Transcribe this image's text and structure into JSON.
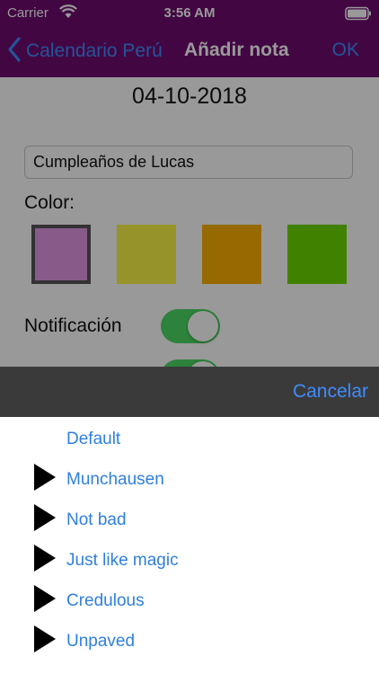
{
  "status_bar": {
    "carrier": "Carrier",
    "time": "3:56 AM"
  },
  "nav": {
    "back_label": "Calendario Perú",
    "title": "Añadir nota",
    "ok_label": "OK"
  },
  "form": {
    "date": "04-10-2018",
    "note_value": "Cumpleaños de Lucas",
    "color_label": "Color:",
    "swatches": [
      {
        "color": "#e197e6",
        "selected": true
      },
      {
        "color": "#f9f545"
      },
      {
        "color": "#fab100"
      },
      {
        "color": "#6cd900"
      }
    ],
    "notification_label": "Notificación",
    "notification_on": true
  },
  "sheet": {
    "cancel_label": "Cancelar",
    "sounds": [
      {
        "label": "Default",
        "icon": "none"
      },
      {
        "label": "Munchausen",
        "icon": "play-icon"
      },
      {
        "label": "Not bad",
        "icon": "play-icon"
      },
      {
        "label": "Just like magic",
        "icon": "play-icon"
      },
      {
        "label": "Credulous",
        "icon": "play-icon"
      },
      {
        "label": "Unpaved",
        "icon": "play-icon"
      }
    ]
  },
  "colors": {
    "nav_background": "#6e0a70",
    "link_blue": "#3f8cff",
    "toggle_green": "#4cd964",
    "list_text": "#2f7fde"
  }
}
